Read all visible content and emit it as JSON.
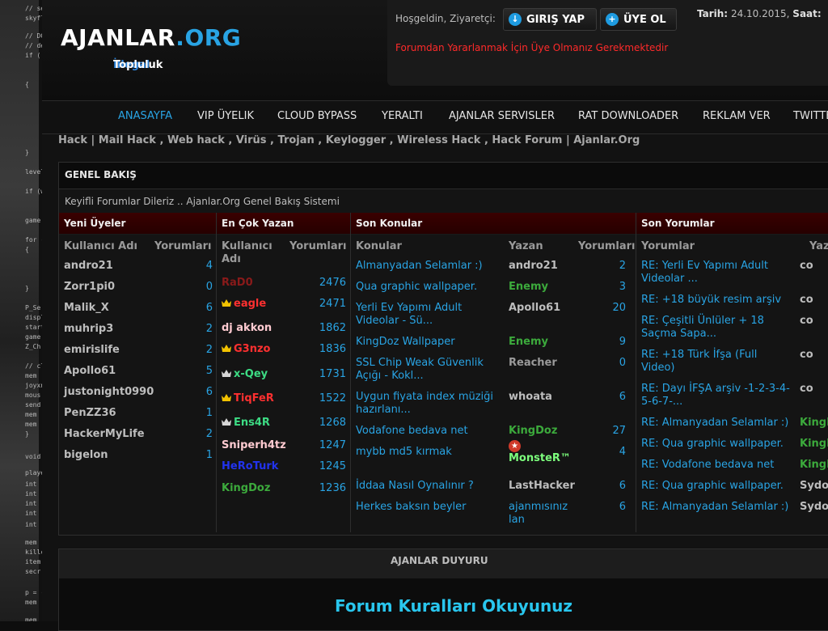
{
  "code_bg": {
    "lines": [
      "// se",
      "skyfla",
      "// DC",
      "// de",
      "if ( (g",
      "{",
      "}",
      "levels",
      "if (wi",
      "game",
      "for (i",
      "{",
      "}",
      "P_Se",
      "displ",
      "start",
      "game",
      "Z_Ch",
      "// cle",
      "mem",
      "joyxn",
      "mous",
      "send",
      "mem",
      "mem",
      "}",
      "void G_",
      "playe",
      "int",
      "int",
      "int",
      "int",
      "int",
      "mem",
      "killco",
      "item",
      "secr",
      "p = (",
      "mem",
      "mem"
    ]
  },
  "header": {
    "logo_main": "AJANLAR",
    "logo_dot": ".",
    "logo_org": "ORG",
    "logo_sub_a": "İllegal",
    "logo_sub_b": "Topluluk",
    "welcome": "Hoşgeldin, Ziyaretçi:",
    "login_label": "GIRIŞ YAP",
    "register_label": "ÜYE OL",
    "date_label": "Tarih:",
    "date_value": "24.10.2015,",
    "time_label": "Saat:",
    "notice": "Forumdan Yararlanmak İçin Üye Olmanız Gerekmektedir"
  },
  "nav": {
    "items": [
      "ANASAYFA",
      "VIP ÜYELIK",
      "CLOUD BYPASS",
      "YERALTI",
      "AJANLAR SERVISLER",
      "RAT DOWNLOADER",
      "REKLAM VER",
      "TWITTER"
    ]
  },
  "breadcrumb": "Hack | Mail Hack , Web hack , Virüs , Trojan , Keylogger , Wireless Hack , Hack Forum | Ajanlar.Org",
  "panel": {
    "title": "GENEL BAKIŞ",
    "desc": "Keyifli Forumlar Dileriz .. Ajanlar.Org Genel Bakış Sistemi",
    "new_members": {
      "heading": "Yeni Üyeler",
      "col1": "Kullanıcı Adı",
      "col2": "Yorumları",
      "rows": [
        {
          "name": "andro21",
          "count": "4"
        },
        {
          "name": "Zorr1pi0",
          "count": "0"
        },
        {
          "name": "Malik_X",
          "count": "6"
        },
        {
          "name": "muhrip3",
          "count": "2"
        },
        {
          "name": "emirislife",
          "count": "2"
        },
        {
          "name": "Apollo61",
          "count": "5"
        },
        {
          "name": "justonight0990",
          "count": "6"
        },
        {
          "name": "PenZZ36",
          "count": "1"
        },
        {
          "name": "HackerMyLife",
          "count": "2"
        },
        {
          "name": "bigelon",
          "count": "1"
        }
      ]
    },
    "top_posters": {
      "heading": "En Çok Yazan",
      "col1a": "Kullanıcı",
      "col1b": "Adı",
      "col2": "Yorumları",
      "rows": [
        {
          "name": "RaD0",
          "count": "2476",
          "color": "#8a1a1a",
          "crown": ""
        },
        {
          "name": "eagle",
          "count": "2471",
          "color": "#ff3030",
          "crown": "gold"
        },
        {
          "name": "dj akkon",
          "count": "1862",
          "color": "#ffcbd1",
          "crown": ""
        },
        {
          "name": "G3nzo",
          "count": "1836",
          "color": "#ff3030",
          "crown": "gold"
        },
        {
          "name": "x-Qey",
          "count": "1731",
          "color": "#3ddc84",
          "crown": "silver"
        },
        {
          "name": "TiqFeR",
          "count": "1522",
          "color": "#ff3030",
          "crown": "gold"
        },
        {
          "name": "Ens4R",
          "count": "1268",
          "color": "#3ddc84",
          "crown": "silver"
        },
        {
          "name": "Sniperh4tz",
          "count": "1247",
          "color": "#ffcbd1",
          "crown": ""
        },
        {
          "name": "HeRoTurk",
          "count": "1245",
          "color": "#2233ee",
          "crown": ""
        },
        {
          "name": "KingDoz",
          "count": "1236",
          "color": "#3caa3c",
          "crown": ""
        }
      ]
    },
    "latest_topics": {
      "heading": "Son Konular",
      "col1": "Konular",
      "col2": "Yazan",
      "col3": "Yorumları",
      "rows": [
        {
          "t1": "Almanyadan Selamlar :)",
          "t2": "",
          "author": "andro21",
          "acolor": "#bdbdbd",
          "count": "2"
        },
        {
          "t1": "Qua graphic wallpaper.",
          "t2": "",
          "author": "Enemy",
          "acolor": "#3caa3c",
          "count": "3"
        },
        {
          "t1": "Yerli Ev Yapımı Adult",
          "t2": "Videolar - Sü...",
          "author": "Apollo61",
          "acolor": "#bdbdbd",
          "count": "20"
        },
        {
          "t1": "KingDoz Wallpaper",
          "t2": "",
          "author": "Enemy",
          "acolor": "#3caa3c",
          "count": "9"
        },
        {
          "t1": "SSL Chip Weak Güvenlik",
          "t2": "Açığı - Kokl...",
          "author": "Reacher",
          "acolor": "#9a9a9a",
          "count": "0"
        },
        {
          "t1": "Uygun fiyata index müziği",
          "t2": "hazırlanı...",
          "author": "whoata",
          "acolor": "#bdbdbd",
          "count": "6"
        },
        {
          "t1": "Vodafone bedava net",
          "t2": "",
          "author": "KingDoz",
          "acolor": "#3caa3c",
          "count": "27"
        },
        {
          "t1": "mybb md5 kırmak",
          "t2": "",
          "author": "MonsteR™",
          "acolor": "#7dff7d",
          "count": "4"
        },
        {
          "t1": "İddaa Nasıl Oynalınır ?",
          "t2": "",
          "author": "LastHacker",
          "acolor": "#bdbdbd",
          "count": "6"
        },
        {
          "t1": "Herkes baksın beyler",
          "t2": "",
          "author": "ajanmısınız",
          "author2": "lan",
          "acolor": "#29a4e4",
          "count": "6"
        }
      ]
    },
    "latest_comments": {
      "heading": "Son Yorumlar",
      "col1": "Yorumlar",
      "col2": "Yazan",
      "rows": [
        {
          "t1": "RE: Yerli Ev Yapımı Adult",
          "t2": "Videolar ...",
          "author": "co",
          "acolor": "#bdbdbd"
        },
        {
          "t1": "RE: +18 büyük resim arşiv",
          "t2": "",
          "author": "co",
          "acolor": "#bdbdbd"
        },
        {
          "t1": "RE: Çeşitli Ünlüler + 18",
          "t2": "Saçma Sapa...",
          "author": "co",
          "acolor": "#bdbdbd"
        },
        {
          "t1": "RE: +18 Türk İfşa (Full",
          "t2": "Video)",
          "author": "co",
          "acolor": "#bdbdbd"
        },
        {
          "t1": "RE: Dayı İFŞA arşiv -1-2-3-4-",
          "t2": "5-6-7-...",
          "author": "co",
          "acolor": "#bdbdbd"
        },
        {
          "t1": "RE: Almanyadan Selamlar :)",
          "t2": "",
          "author": "KingD",
          "acolor": "#3caa3c"
        },
        {
          "t1": "RE: Qua graphic wallpaper.",
          "t2": "",
          "author": "KingD",
          "acolor": "#3caa3c"
        },
        {
          "t1": "RE: Vodafone bedava net",
          "t2": "",
          "author": "KingD",
          "acolor": "#3caa3c"
        },
        {
          "t1": "RE: Qua graphic wallpaper.",
          "t2": "",
          "author": "Sydon",
          "acolor": "#bdbdbd"
        },
        {
          "t1": "RE: Almanyadan Selamlar :)",
          "t2": "",
          "author": "Sydon",
          "acolor": "#bdbdbd"
        }
      ]
    }
  },
  "announcement": {
    "title": "AJANLAR DUYURU",
    "headline": "Forum Kuralları Okuyunuz"
  }
}
